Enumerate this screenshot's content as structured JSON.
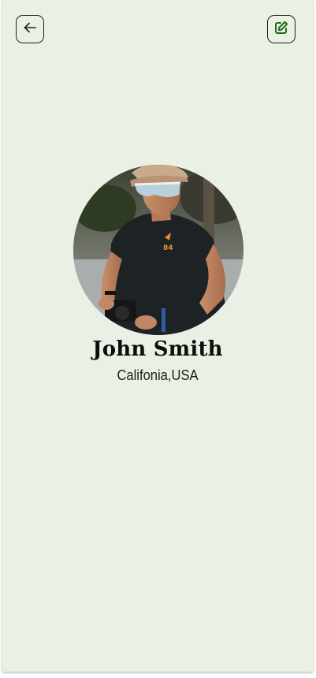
{
  "header": {
    "back_icon": "arrow-left-icon",
    "edit_icon": "edit-pencil-icon",
    "accent_color": "#1f6b1a"
  },
  "profile": {
    "name": "John Smith",
    "location": "Califonia,USA"
  },
  "colors": {
    "background": "#eaf0e3",
    "text": "#0d0d0d"
  }
}
